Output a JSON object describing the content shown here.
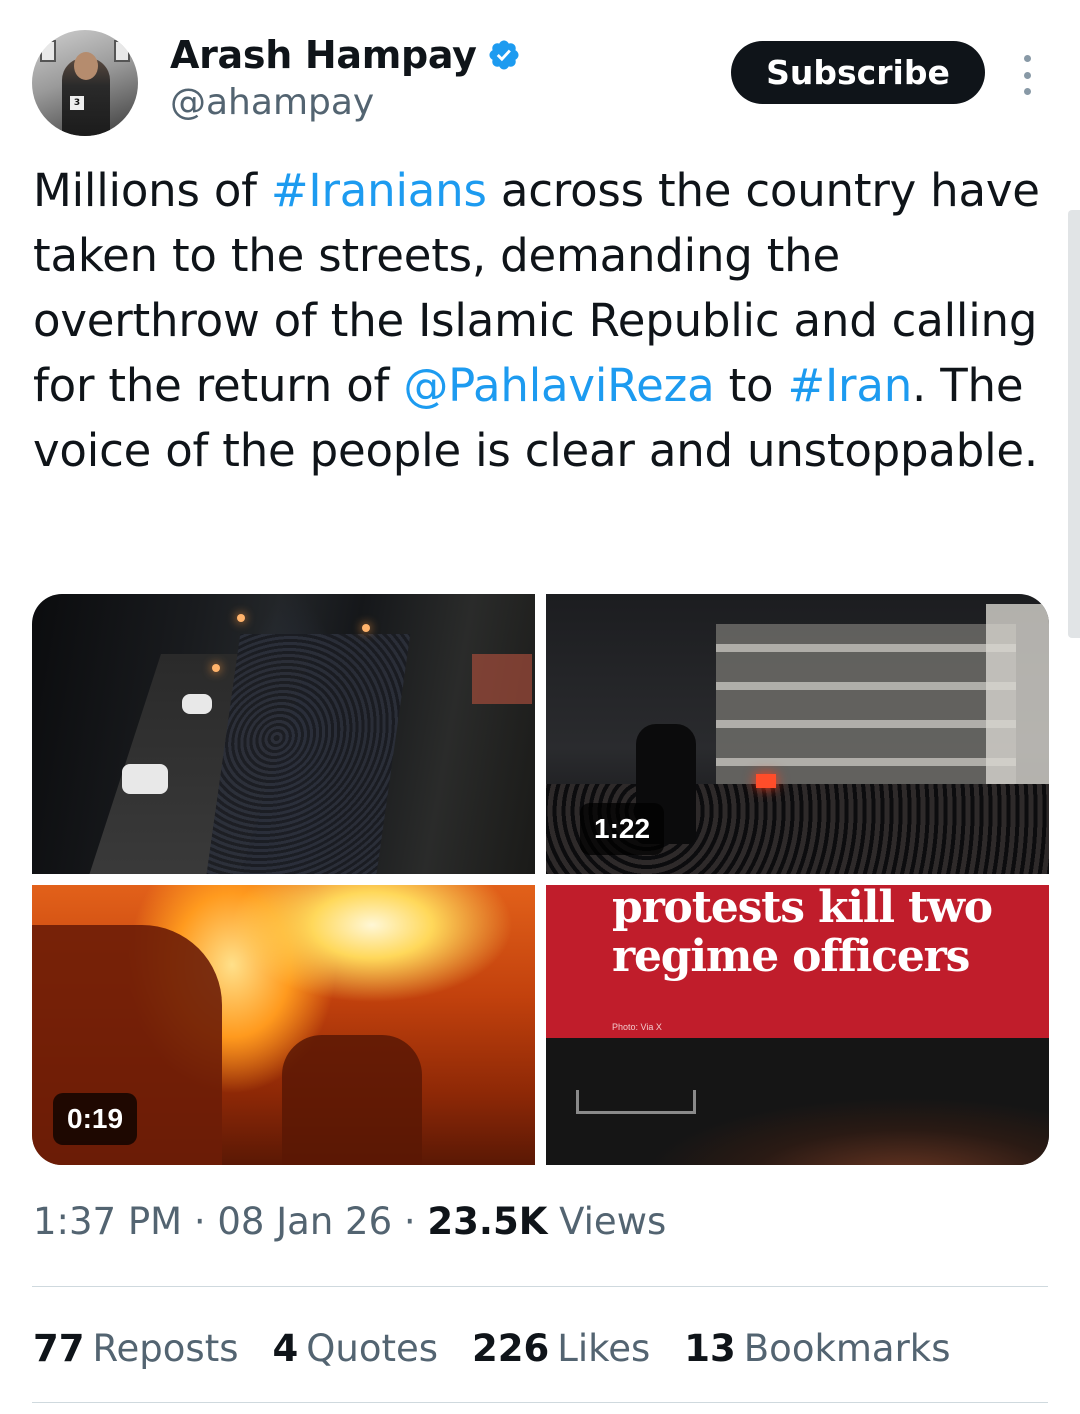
{
  "author": {
    "display_name": "Arash Hampay",
    "handle": "@ahampay",
    "verified": true,
    "avatar_bib": "3"
  },
  "actions": {
    "subscribe_label": "Subscribe",
    "more_icon": "more-vertical-icon"
  },
  "tweet": {
    "segments": [
      {
        "text": "Millions of ",
        "type": "text"
      },
      {
        "text": "#Iranians",
        "type": "hashtag"
      },
      {
        "text": " across the country have taken to the streets, demanding the overthrow of the Islamic Republic and calling for the return of ",
        "type": "text"
      },
      {
        "text": "@PahlaviReza",
        "type": "mention"
      },
      {
        "text": " to ",
        "type": "text"
      },
      {
        "text": "#Iran",
        "type": "hashtag"
      },
      {
        "text": ". The voice of the people is clear and unstoppable.",
        "type": "text"
      }
    ]
  },
  "media": {
    "video_2_duration": "1:22",
    "video_3_duration": "0:19",
    "image_4_headline": "protests kill two regime officers",
    "image_4_credit": "Photo: Via X"
  },
  "meta": {
    "time": "1:37 PM",
    "sep1": " · ",
    "date": "08 Jan 26",
    "sep2": " · ",
    "views_count": "23.5K",
    "views_label": " Views"
  },
  "stats": {
    "reposts_count": "77",
    "reposts_label": "Reposts",
    "quotes_count": "4",
    "quotes_label": "Quotes",
    "likes_count": "226",
    "likes_label": "Likes",
    "bookmarks_count": "13",
    "bookmarks_label": "Bookmarks"
  },
  "colors": {
    "link": "#1d9bf0",
    "verified": "#1d9bf0",
    "text_primary": "#0f1419",
    "text_secondary": "#536471",
    "headline_banner": "#c01d2b"
  }
}
